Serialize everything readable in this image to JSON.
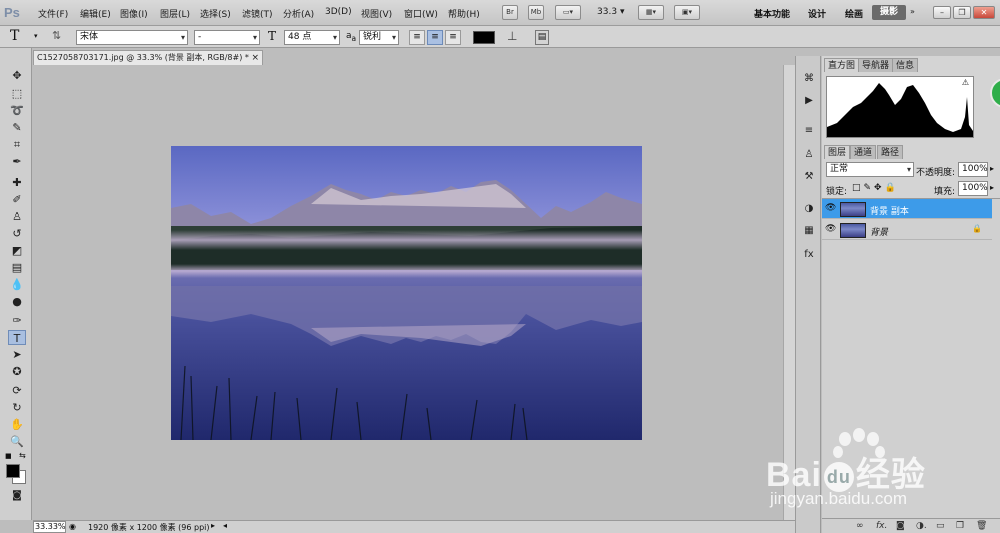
{
  "app": {
    "logo": "Ps"
  },
  "menubar": {
    "items": [
      "文件(F)",
      "编辑(E)",
      "图像(I)",
      "图层(L)",
      "选择(S)",
      "滤镜(T)",
      "分析(A)",
      "3D(D)",
      "视图(V)",
      "窗口(W)",
      "帮助(H)"
    ],
    "bridge_label": "Br",
    "minibridge_label": "Mb",
    "zoom": "33.3",
    "workspaces": [
      "基本功能",
      "设计",
      "绘画"
    ],
    "active_workspace": "摄影"
  },
  "options": {
    "tool_glyph": "T",
    "font_family": "宋体",
    "font_style": "-",
    "font_size": "48 点",
    "aa_label": "a",
    "aa_sub": "a",
    "antialias": "锐利",
    "text_color": "#000000"
  },
  "document": {
    "tab_title": "C1527058703171.jpg @ 33.3% (背景 副本, RGB/8#) *",
    "close_glyph": "×"
  },
  "status": {
    "zoom": "33.33%",
    "doc_info": "1920 像素 x 1200 像素 (96 ppi)"
  },
  "panels": {
    "top_tabs": [
      "直方图",
      "导航器",
      "信息"
    ],
    "layer_tabs": [
      "图层",
      "通道",
      "路径"
    ],
    "blend_mode": "正常",
    "opacity_label": "不透明度:",
    "opacity": "100%",
    "lock_label": "锁定:",
    "fill_label": "填充:",
    "fill": "100%",
    "layers": [
      {
        "name": "背景 副本",
        "selected": true
      },
      {
        "name": "背景",
        "selected": false,
        "locked": true
      }
    ],
    "bottom_icons": [
      "link-icon",
      "fx-icon",
      "mask-icon",
      "adjustment-icon",
      "group-icon",
      "new-layer-icon",
      "trash-icon"
    ]
  },
  "watermark": {
    "brand_left": "Bai",
    "brand_right": "经验",
    "url": "jingyan.baidu.com"
  },
  "colors": {
    "selection": "#3d9be9",
    "accent": "#a9bfe0"
  }
}
